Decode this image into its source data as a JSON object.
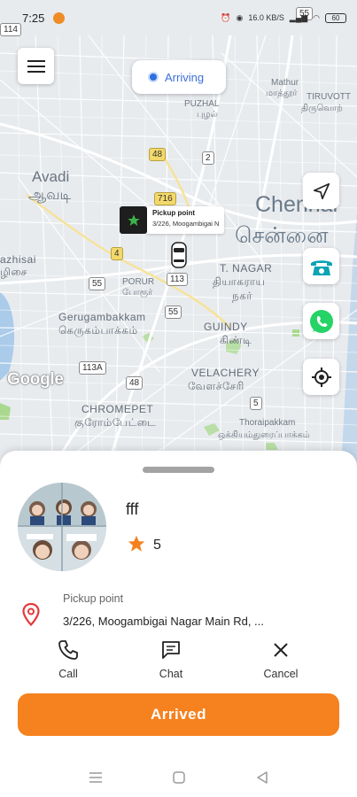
{
  "status_bar": {
    "time": "7:25",
    "network_speed": "16.0 KB/S",
    "battery": "60"
  },
  "map": {
    "status_pill": "Arriving",
    "pickup_marker": {
      "title": "Pickup point",
      "address": "3/226, Moogambigai N"
    },
    "attribution": "Google",
    "labels": {
      "mathur": "Mathur",
      "mathur_ta": "மாத்தூர்",
      "puzhal": "PUZHAL",
      "puzhal_ta": "புழல்",
      "tiruvottiyur": "TIRUVOTT",
      "tiruvottiyur_ta": "திருவொற்",
      "avadi": "Avadi",
      "avadi_ta": "ஆவடி",
      "chennai": "Chennai",
      "chennai_ta": "சென்னை",
      "azhisai": "azhisai",
      "azhisai_ta": "ழிசை",
      "porur": "PORUR",
      "porur_ta": "போரூர்",
      "tnagar": "T. NAGAR",
      "tnagar_ta": "தியாகராய",
      "tnagar_ta2": "நகர்",
      "gerugambakkam": "Gerugambakkam",
      "gerugambakkam_ta": "கெருகம்பாக்கம்",
      "guindy": "GUINDY",
      "guindy_ta": "கிண்டி",
      "velachery": "VELACHERY",
      "velachery_ta": "வேளச்சேரி",
      "chromepet": "CHROMEPET",
      "chromepet_ta": "குரோம்பேட்டை",
      "thoraipakkam": "Thoraipakkam",
      "thoraipakkam_ta": "ஒக்கியம்துரைப்பாக்கம்"
    },
    "shields": [
      "114",
      "55",
      "48",
      "2",
      "716",
      "4",
      "55",
      "113",
      "55",
      "113A",
      "48",
      "5"
    ]
  },
  "driver": {
    "name": "fff",
    "rating": "5"
  },
  "pickup": {
    "label": "Pickup point",
    "address": "3/226, Moogambigai Nagar Main Rd, ..."
  },
  "actions": {
    "call": "Call",
    "chat": "Chat",
    "cancel": "Cancel"
  },
  "primary_button": "Arrived",
  "colors": {
    "accent": "#f5821f",
    "status_blue": "#2f6fe0",
    "whatsapp": "#25d366",
    "phone_teal": "#0aa4b5",
    "location_red": "#e5383b"
  },
  "icons": {
    "menu": "menu-icon",
    "navigate": "send-icon",
    "phone": "phone-icon",
    "whatsapp": "whatsapp-icon",
    "locate": "my-location-icon",
    "pin": "location-pin-icon",
    "star": "star-icon"
  }
}
